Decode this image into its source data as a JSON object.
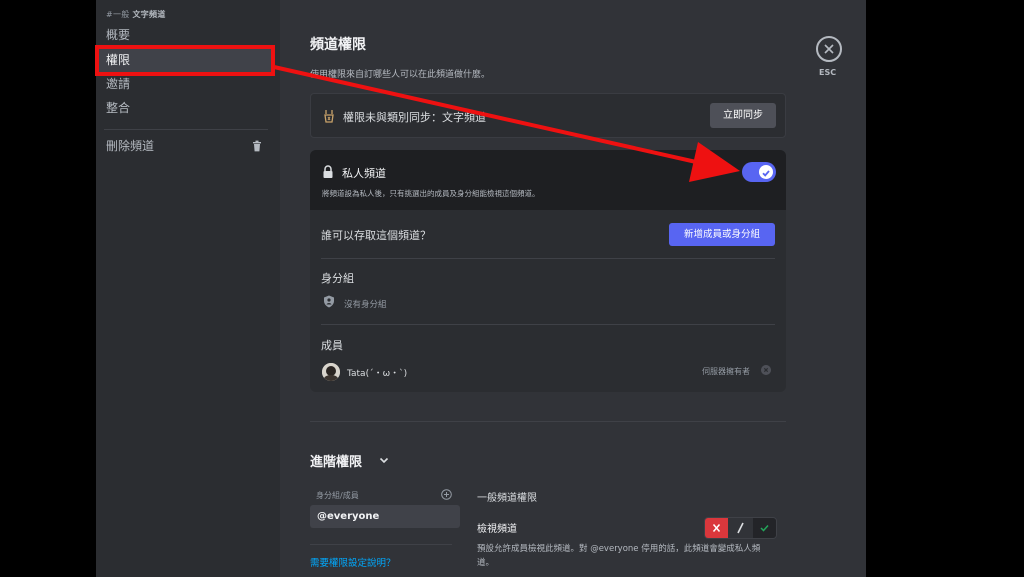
{
  "sidebar": {
    "header_prefix": "#一般",
    "header_bold": "文字頻道",
    "items": [
      {
        "label": "概要"
      },
      {
        "label": "權限"
      },
      {
        "label": "邀請"
      },
      {
        "label": "整合"
      }
    ],
    "delete_label": "刪除頻道"
  },
  "main": {
    "title": "頻道權限",
    "subtitle": "使用權限來自訂哪些人可以在此頻道做什麼。",
    "sync": {
      "text": "權限未與類別同步：文字頻道",
      "button": "立即同步"
    },
    "private": {
      "label": "私人頻道",
      "description": "將頻道設為私人後，只有挑選出的成員及身分組能檢視這個頻道。",
      "enabled": true
    },
    "access": {
      "question": "誰可以存取這個頻道？",
      "add_button": "新增成員或身分組"
    },
    "roles": {
      "label": "身分組",
      "empty": "沒有身分組"
    },
    "members": {
      "label": "成員",
      "list": [
        {
          "name": "Tata(ˊ・ω・ˋ)",
          "tag": "伺服器擁有者"
        }
      ]
    },
    "advanced": {
      "title": "進階權限",
      "roles_header": "身分組/成員",
      "everyone": "@everyone",
      "help_link": "需要權限設定說明？",
      "general_header": "一般頻道權限",
      "permission": {
        "name": "檢視頻道",
        "description": "預設允許成員檢視此頻道。對 @everyone 停用的話，此頻道會變成私人頻道。",
        "separator": "/"
      }
    }
  },
  "esc": {
    "label": "ESC"
  },
  "colors": {
    "accent": "#5865f2",
    "deny": "#da373c",
    "allow": "#23a55a",
    "annotation": "#ee1111",
    "link": "#00a8fc"
  }
}
